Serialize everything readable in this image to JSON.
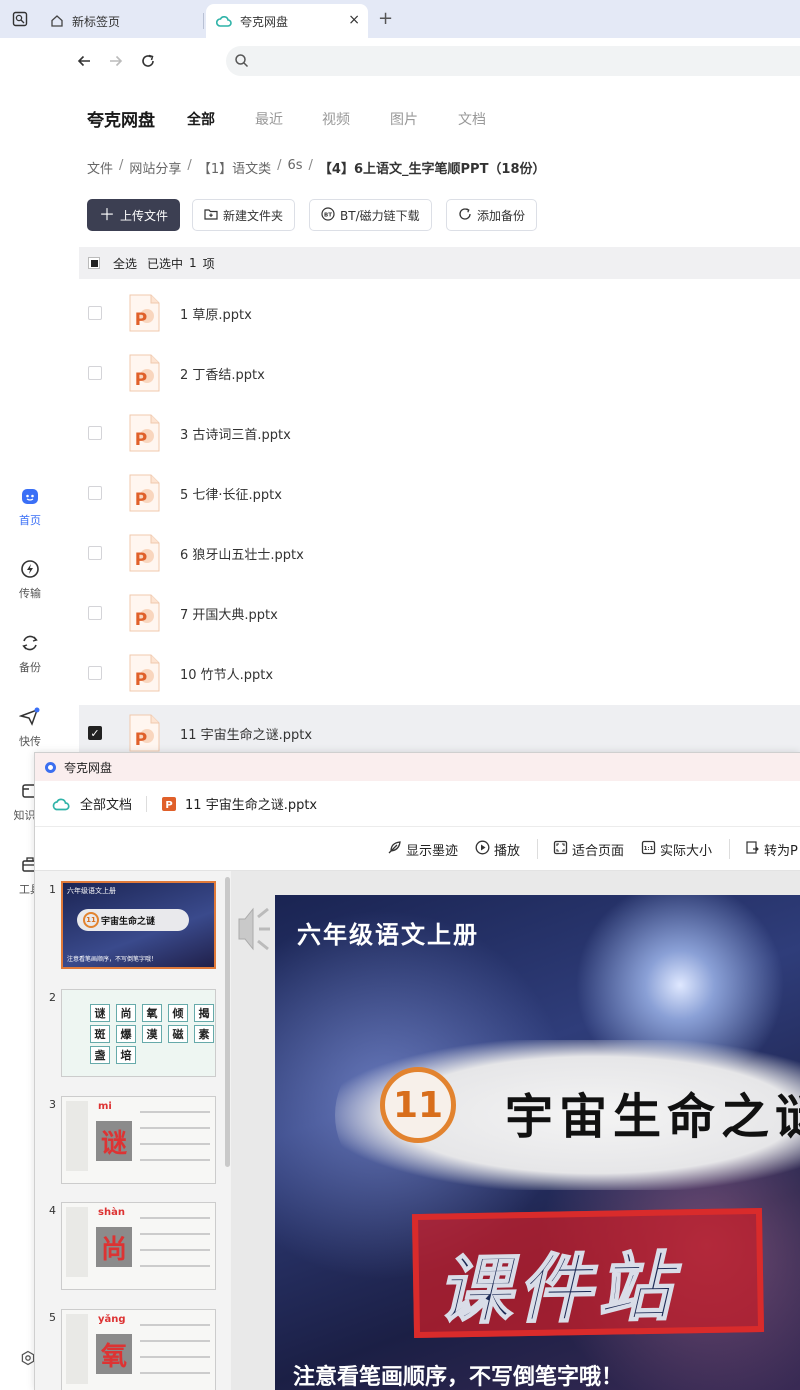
{
  "browser": {
    "tabs": [
      {
        "label": "新标签页"
      },
      {
        "label": "夸克网盘"
      }
    ],
    "new_tab": "+",
    "close": "×"
  },
  "rail": {
    "items": [
      {
        "label": "首页"
      },
      {
        "label": "传输"
      },
      {
        "label": "备份"
      },
      {
        "label": "快传"
      },
      {
        "label": "知识库"
      },
      {
        "label": "工具"
      }
    ]
  },
  "main": {
    "brand": "夸克网盘",
    "categories": [
      "全部",
      "最近",
      "视频",
      "图片",
      "文档"
    ],
    "breadcrumb": [
      "文件",
      "网站分享",
      "【1】语文类",
      "6s",
      "【4】6上语文_生字笔顺PPT（18份）"
    ],
    "breadcrumb_sep": "/",
    "buttons": {
      "upload": "上传文件",
      "new_folder": "新建文件夹",
      "bt": "BT/磁力链下载",
      "backup": "添加备份"
    },
    "selection": {
      "select_all": "全选",
      "selected_prefix": "已选中",
      "count": "1",
      "unit": "项"
    },
    "files": [
      {
        "name": "1 草原.pptx",
        "checked": false
      },
      {
        "name": "2 丁香结.pptx",
        "checked": false
      },
      {
        "name": "3 古诗词三首.pptx",
        "checked": false
      },
      {
        "name": "5 七律·长征.pptx",
        "checked": false
      },
      {
        "name": "6 狼牙山五壮士.pptx",
        "checked": false
      },
      {
        "name": "7 开国大典.pptx",
        "checked": false
      },
      {
        "name": "10 竹节人.pptx",
        "checked": false
      },
      {
        "name": "11 宇宙生命之谜.pptx",
        "checked": true
      }
    ]
  },
  "preview": {
    "window_title": "夸克网盘",
    "all_docs": "全部文档",
    "file_name": "11 宇宙生命之谜.pptx",
    "tools": {
      "ink": "显示墨迹",
      "play": "播放",
      "fit": "适合页面",
      "actual": "实际大小",
      "convert": "转为P"
    },
    "thumb_numbers": [
      "1",
      "2",
      "3",
      "4",
      "5"
    ],
    "thumb1": {
      "header": "六年级语文上册",
      "num": "11",
      "title": "宇宙生命之谜",
      "footer": "注意看笔画顺序，不写倒笔字哦！"
    },
    "thumb2": {
      "chars": [
        "谜",
        "尚",
        "氧",
        "倾",
        "揭",
        "斑",
        "爆",
        "漠",
        "磁",
        "素",
        "盏",
        "培"
      ]
    },
    "thumb3": {
      "pinyin": "mi",
      "char": "谜"
    },
    "thumb4": {
      "pinyin": "shàn",
      "char": "尚"
    },
    "thumb5": {
      "pinyin": "yǎng",
      "char": "氧"
    },
    "slide": {
      "grade": "六年级语文上册",
      "lesson_number": "11",
      "title": "宇宙生命之谜",
      "stamp": "课件站",
      "footer": "注意看笔画顺序，不写倒笔字哦！"
    }
  },
  "colors": {
    "accent": "#3a6ff6",
    "ppt_orange": "#e0602a",
    "primary_btn": "#3c3f52"
  }
}
